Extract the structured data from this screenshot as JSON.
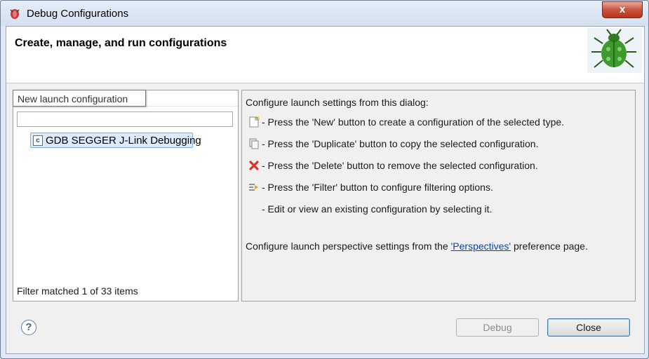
{
  "window": {
    "title": "Debug Configurations",
    "close_glyph": "x"
  },
  "header": {
    "title": "Create, manage, and run configurations"
  },
  "left_panel": {
    "toolbar": [
      {
        "icon": "new-config-icon"
      },
      {
        "icon": "duplicate-icon"
      },
      {
        "icon": "delete-icon"
      },
      {
        "icon": "collapse-all-icon"
      },
      {
        "icon": "filter-icon"
      },
      {
        "icon": "view-menu-dropdown-icon"
      }
    ],
    "filter_value": "",
    "tooltip": "New launch configuration",
    "tree": [
      {
        "type_icon": "c-icon",
        "type_letter": "c",
        "label": "GDB SEGGER J-Link Debugging"
      }
    ],
    "status": "Filter matched 1 of 33 items"
  },
  "right_panel": {
    "intro": "Configure launch settings from this dialog:",
    "lines": [
      {
        "icon": "new-config-icon",
        "text": "- Press the 'New' button to create a configuration of the selected type."
      },
      {
        "icon": "duplicate-icon",
        "text": "- Press the 'Duplicate' button to copy the selected configuration."
      },
      {
        "icon": "delete-icon",
        "text": "- Press the 'Delete' button to remove the selected configuration."
      },
      {
        "icon": "filter-icon",
        "text": "- Press the 'Filter' button to configure filtering options."
      },
      {
        "icon": "",
        "text": "- Edit or view an existing configuration by selecting it."
      }
    ],
    "perspectives_prefix": "Configure launch perspective settings from the ",
    "perspectives_link": "'Perspectives'",
    "perspectives_suffix": " preference page."
  },
  "footer": {
    "help_glyph": "?",
    "debug_label": "Debug",
    "close_label": "Close"
  },
  "colors": {
    "accent_selection": "#dcebfc",
    "link": "#0645ad",
    "delete_red": "#d9342b"
  }
}
